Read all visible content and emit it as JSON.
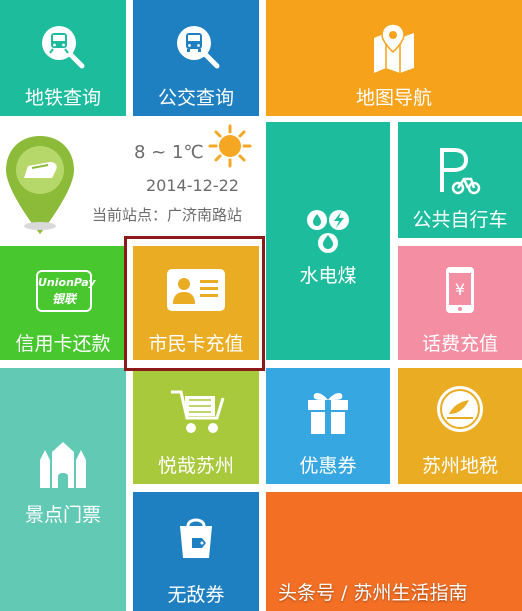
{
  "tiles": {
    "subway": "地铁查询",
    "bus": "公交查询",
    "map": "地图导航",
    "bike": "公共自行车",
    "utility": "水电煤",
    "credit": "信用卡还款",
    "citizen_card": "市民卡充值",
    "phone": "话费充值",
    "shopping": "悦哉苏州",
    "coupon": "优惠券",
    "tax": "苏州地税",
    "tickets": "景点门票",
    "wudi": "无敌券"
  },
  "unionpay": {
    "line1": "UnionPay",
    "line2": "银联"
  },
  "weather": {
    "temp": "8 ~ 1℃",
    "date": "2014-12-22",
    "station": "当前站点：广济南路站"
  },
  "watermark": "头条号 / 苏州生活指南",
  "colors": {
    "teal": "#1cbc9c",
    "blue": "#1e7fc1",
    "orange": "#f7a21b",
    "green": "#48c72f",
    "gold": "#e9ac22",
    "pink": "#f48ea3",
    "light_teal": "#61c9b4",
    "lime": "#a8c93b",
    "sky": "#36a7e1",
    "highlight": "#8b1a1a"
  }
}
